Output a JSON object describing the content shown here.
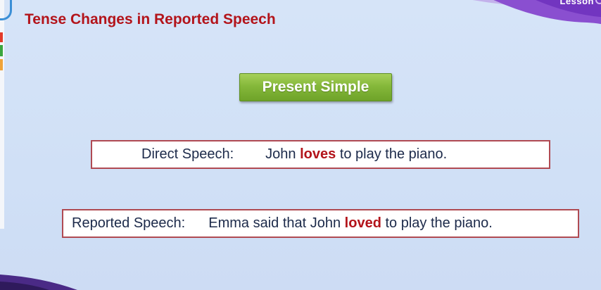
{
  "slide": {
    "title": "Tense Changes in Reported Speech",
    "corner_label": "Lesson",
    "tense": "Present Simple",
    "direct": {
      "label": "Direct Speech:",
      "before": "John ",
      "verb": "loves",
      "after": " to play the piano."
    },
    "reported": {
      "label": "Reported Speech:",
      "before": "Emma said that John ",
      "verb": "loved",
      "after": " to play the piano."
    }
  },
  "colors": {
    "title": "#b3141b",
    "verb_highlight": "#b3141b",
    "badge_green": "#85b83a",
    "box_border": "#b04a52",
    "background": "#d3e2f7",
    "corner_purple": "#7a3fc2"
  }
}
